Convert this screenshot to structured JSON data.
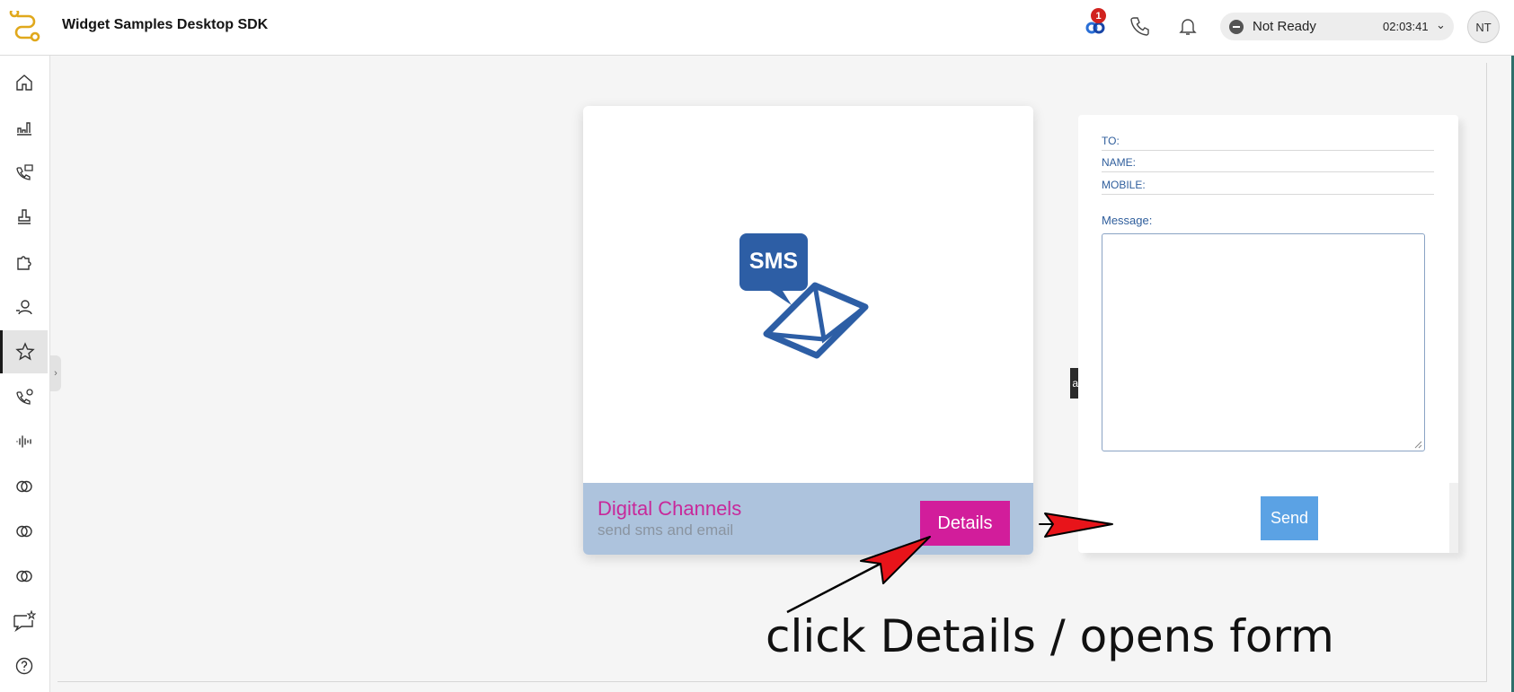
{
  "header": {
    "app_title": "Widget Samples Desktop SDK",
    "notification_count": "1",
    "agent_state": "Not Ready",
    "state_timer": "02:03:41",
    "avatar_initials": "NT"
  },
  "sidebar": {
    "items": [
      {
        "icon": "home-icon"
      },
      {
        "icon": "bar-chart-icon"
      },
      {
        "icon": "call-history-icon"
      },
      {
        "icon": "stamp-icon"
      },
      {
        "icon": "puzzle-icon"
      },
      {
        "icon": "user-icon"
      },
      {
        "icon": "star-icon",
        "active": true
      },
      {
        "icon": "call-settings-icon"
      },
      {
        "icon": "waveform-icon"
      },
      {
        "icon": "rings-icon"
      },
      {
        "icon": "rings-icon"
      },
      {
        "icon": "rings-icon"
      },
      {
        "icon": "chat-star-icon"
      },
      {
        "icon": "help-icon"
      }
    ]
  },
  "card": {
    "title": "Digital Channels",
    "subtitle": "send sms and email",
    "button_label": "Details",
    "illustration_text": "SMS"
  },
  "form": {
    "to_label": "TO:",
    "name_label": "NAME:",
    "mobile_label": "MOBILE:",
    "message_label": "Message:",
    "send_label": "Send"
  },
  "tooltip": {
    "text": "al Card"
  },
  "annotation": {
    "text": "click Details / opens form"
  },
  "colors": {
    "card_title": "#c8289a",
    "details_button": "#d21d9b",
    "send_button": "#5ba2e4",
    "card_footer": "#adc3dd",
    "form_label": "#2f5e9c",
    "arrow_fill": "#e8141a"
  }
}
